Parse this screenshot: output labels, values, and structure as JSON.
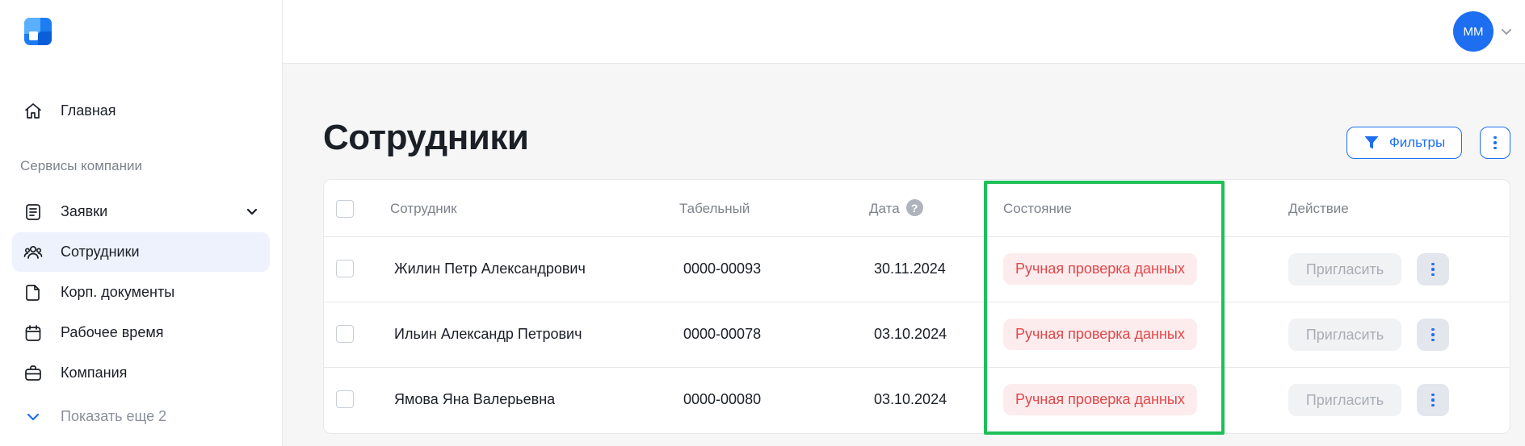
{
  "sidebar": {
    "section_label": "Сервисы компании",
    "items": [
      {
        "label": "Главная",
        "icon": "home-icon"
      },
      {
        "label": "Заявки",
        "icon": "list-document-icon"
      },
      {
        "label": "Сотрудники",
        "icon": "users-icon"
      },
      {
        "label": "Корп. документы",
        "icon": "file-icon"
      },
      {
        "label": "Рабочее время",
        "icon": "calendar-icon"
      },
      {
        "label": "Компания",
        "icon": "briefcase-icon"
      }
    ],
    "show_more_label": "Показать еще 2"
  },
  "header": {
    "avatar_initials": "MM"
  },
  "page": {
    "title": "Сотрудники",
    "filters_label": "Фильтры"
  },
  "table": {
    "columns": {
      "employee": "Сотрудник",
      "tab_number": "Табельный",
      "date": "Дата",
      "date_help": "?",
      "status": "Состояние",
      "action": "Действие"
    },
    "rows": [
      {
        "name": "Жилин Петр Александрович",
        "tab_number": "0000-00093",
        "date": "30.11.2024",
        "status": "Ручная проверка данных",
        "action": "Пригласить"
      },
      {
        "name": "Ильин Александр Петрович",
        "tab_number": "0000-00078",
        "date": "03.10.2024",
        "status": "Ручная проверка данных",
        "action": "Пригласить"
      },
      {
        "name": "Ямова Яна Валерьевна",
        "tab_number": "0000-00080",
        "date": "03.10.2024",
        "status": "Ручная проверка данных",
        "action": "Пригласить"
      }
    ]
  },
  "colors": {
    "accent": "#1d6ef0",
    "status_text": "#e04848",
    "status_bg": "#fdecee",
    "highlight": "#1fbf5a",
    "active_nav_bg": "#edf2fd"
  }
}
